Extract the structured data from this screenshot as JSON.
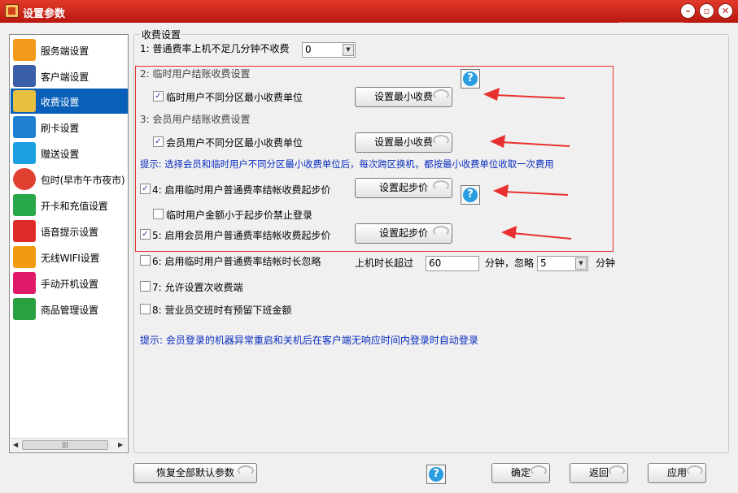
{
  "window": {
    "title": "设置参数",
    "min_icon": "minimize-icon",
    "max_icon": "maximize-icon",
    "close_icon": "close-icon"
  },
  "sidebar": {
    "items": [
      {
        "label": "服务端设置",
        "icon": "server-icon",
        "color": "#f39a1a"
      },
      {
        "label": "客户端设置",
        "icon": "monitor-icon",
        "color": "#3a5fa8"
      },
      {
        "label": "收费设置",
        "icon": "billing-icon",
        "color": "#e8c040",
        "active": true
      },
      {
        "label": "刷卡设置",
        "icon": "card-icon",
        "color": "#1f7fd0"
      },
      {
        "label": "赠送设置",
        "icon": "gift-icon",
        "color": "#1aa0e0"
      },
      {
        "label": "包时(早市午市夜市)",
        "icon": "clock-icon",
        "color": "#e04030"
      },
      {
        "label": "开卡和充值设置",
        "icon": "id-card-icon",
        "color": "#28a848"
      },
      {
        "label": "语音提示设置",
        "icon": "microphone-icon",
        "color": "#e02a2a"
      },
      {
        "label": "无线WIFI设置",
        "icon": "wifi-icon",
        "color": "#f29a10"
      },
      {
        "label": "手动开机设置",
        "icon": "hand-power-icon",
        "color": "#e01a6a"
      },
      {
        "label": "商品管理设置",
        "icon": "cart-icon",
        "color": "#2aa040"
      }
    ]
  },
  "section": {
    "title": "收费设置"
  },
  "rows": {
    "r1": {
      "label": "1: 普通费率上机不足几分钟不收费",
      "value": "0"
    },
    "r2": {
      "label": "2: 临时用户结账收费设置",
      "sub": "临时用户不同分区最小收费单位",
      "button": "设置最小收费",
      "checked": true
    },
    "r3": {
      "label": "3: 会员用户结账收费设置",
      "sub": "会员用户不同分区最小收费单位",
      "button": "设置最小收费",
      "checked": true
    },
    "tip1": "提示: 选择会员和临时用户不同分区最小收费单位后，每次跨区换机，都按最小收费单位收取一次费用",
    "r4": {
      "label": "4: 启用临时用户普通费率结帐收费起步价",
      "button": "设置起步价",
      "checked": true
    },
    "r4b": {
      "label": "临时用户金额小于起步价禁止登录",
      "checked": false
    },
    "r5": {
      "label": "5: 启用会员用户普通费率结帐收费起步价",
      "button": "设置起步价",
      "checked": true
    },
    "r6": {
      "label": "6: 启用临时用户普通费率结帐时长忽略",
      "pre": "上机时长超过",
      "minutes": "60",
      "mid": "分钟，忽略",
      "ignore": "5",
      "post": "分钟",
      "checked": false
    },
    "r7": {
      "label": "7: 允许设置次收费端",
      "checked": false
    },
    "r8": {
      "label": "8: 营业员交班时有预留下班金额",
      "checked": false
    },
    "tip2": "提示: 会员登录的机器异常重启和关机后在客户端无响应时间内登录时自动登录"
  },
  "footer": {
    "restore": "恢复全部默认参数",
    "ok": "确定",
    "back": "返回",
    "apply": "应用"
  },
  "help": "?",
  "colors": {
    "title_bar": "#c8201a",
    "selection": "#0a5fb8",
    "tip": "#0a2dc0",
    "highlight_box": "#e03030",
    "arrow": "#e83030"
  }
}
